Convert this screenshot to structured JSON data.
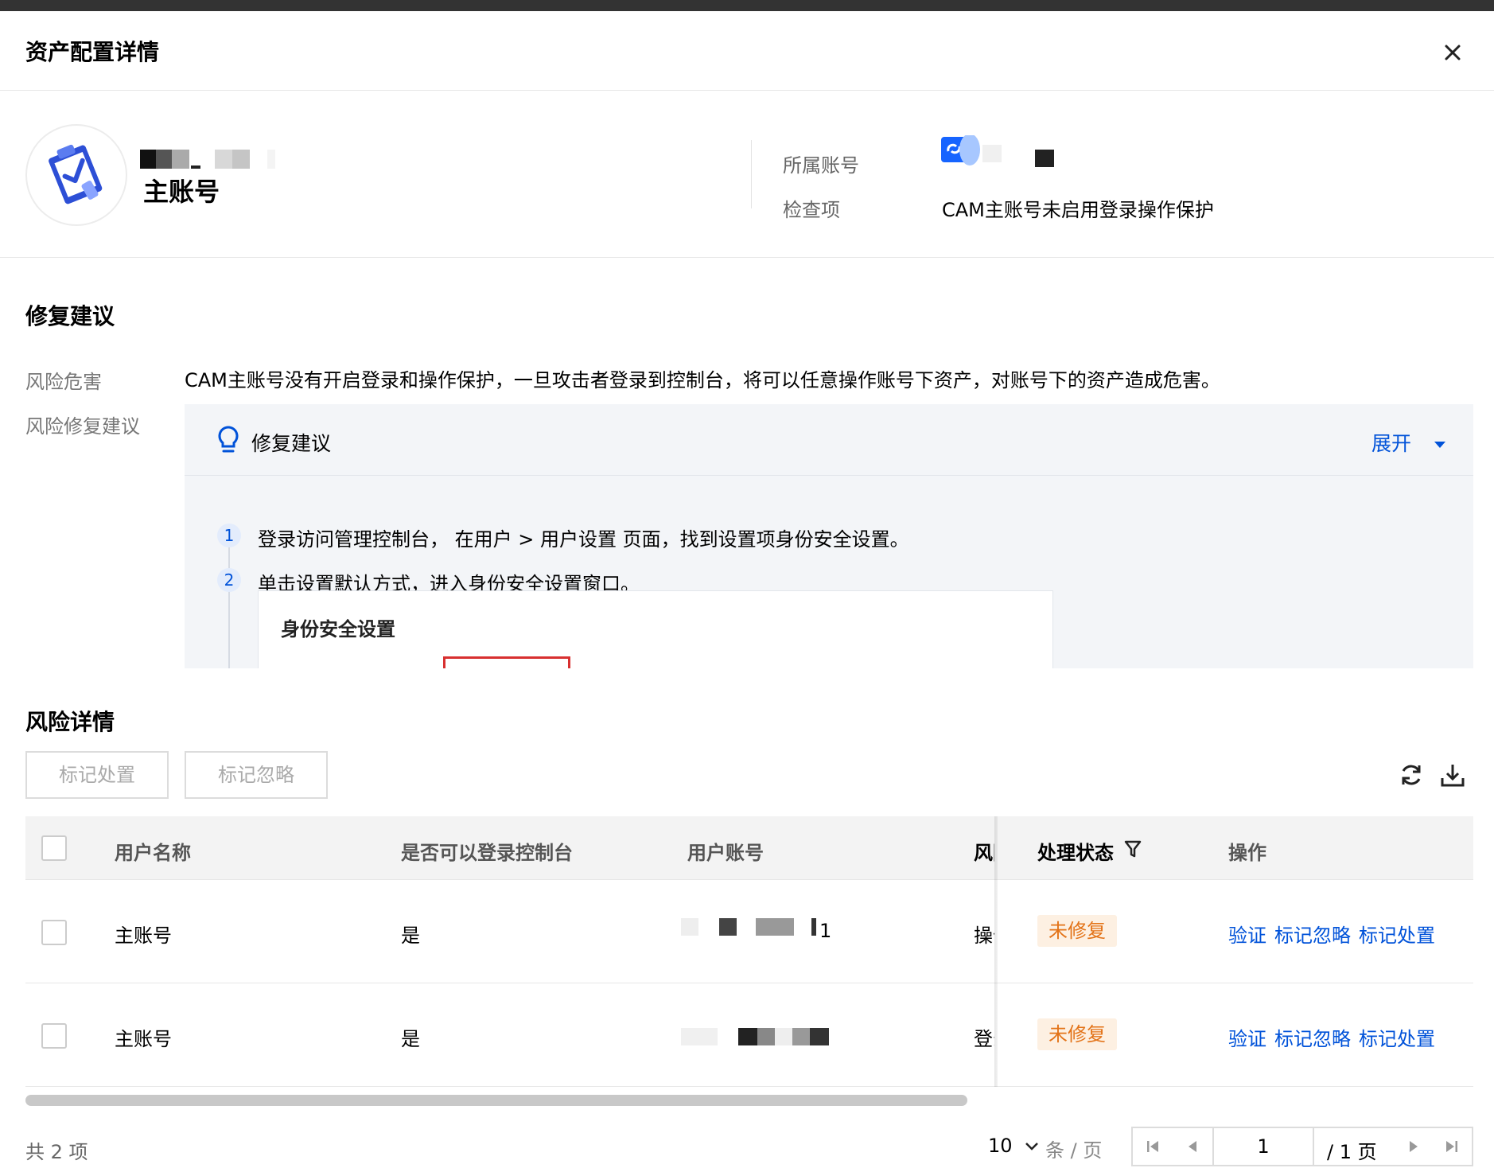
{
  "dialog": {
    "title": "资产配置详情",
    "close_icon": "close-icon"
  },
  "summary": {
    "account_type": "主账号",
    "owner_label": "所属账号",
    "check_label": "检查项",
    "check_value": "CAM主账号未启用登录操作保护"
  },
  "remediation": {
    "section_title": "修复建议",
    "risk_label": "风险危害",
    "risk_text": "CAM主账号没有开启登录和操作保护，一旦攻击者登录到控制台，将可以任意操作账号下资产，对账号下的资产造成危害。",
    "fix_label": "风险修复建议",
    "panel_title": "修复建议",
    "expand_label": "展开",
    "steps": [
      {
        "num": "1",
        "text": "登录访问管理控制台， 在用户 > 用户设置 页面，找到设置项身份安全设置。"
      },
      {
        "num": "2",
        "text": "单击设置默认方式，进入身份安全设置窗口。"
      }
    ],
    "screenshot_title": "身份安全设置"
  },
  "risk_details": {
    "section_title": "风险详情",
    "mark_handled_button": "标记处置",
    "mark_ignore_button": "标记忽略",
    "columns": [
      "用户名称",
      "是否可以登录控制台",
      "用户账号",
      "风险",
      "处理状态",
      "操作"
    ],
    "rows": [
      {
        "user_name": "主账号",
        "console_login": "是",
        "account_suffix": "1",
        "risk_snippet": "操作",
        "status": "未修复",
        "actions": [
          "验证",
          "标记忽略",
          "标记处置"
        ]
      },
      {
        "user_name": "主账号",
        "console_login": "是",
        "account_suffix": "",
        "risk_snippet": "登录",
        "status": "未修复",
        "actions": [
          "验证",
          "标记忽略",
          "标记处置"
        ]
      }
    ]
  },
  "pagination": {
    "total_text": "共 2 项",
    "page_size": "10",
    "page_size_unit": "条 / 页",
    "current_page": "1",
    "total_pages_text": "/ 1 页"
  },
  "colors": {
    "primary": "#0052d9",
    "warning_text": "#e37318",
    "warning_bg": "#fdf0e2"
  }
}
